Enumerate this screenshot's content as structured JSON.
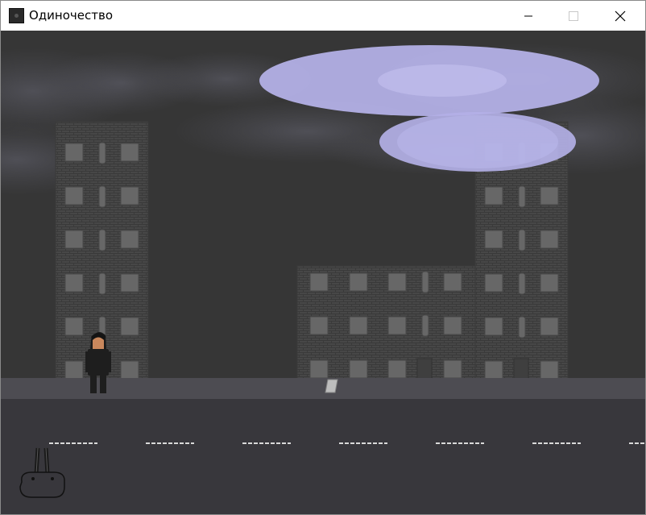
{
  "window": {
    "title": "Одиночество",
    "controls": [
      "minimize",
      "maximize",
      "close"
    ]
  },
  "scene": {
    "sky_color": "#363636",
    "ufo_color": "#b3b0e6",
    "road_color": "#38373c",
    "sidewalk_color": "#4d4c52",
    "lane_marking_color": "#d9d9d9",
    "building_color": "#474747",
    "window_color": "#6a6a6a"
  },
  "icons": {
    "app": "app-icon",
    "joystick": "joystick-icon"
  }
}
